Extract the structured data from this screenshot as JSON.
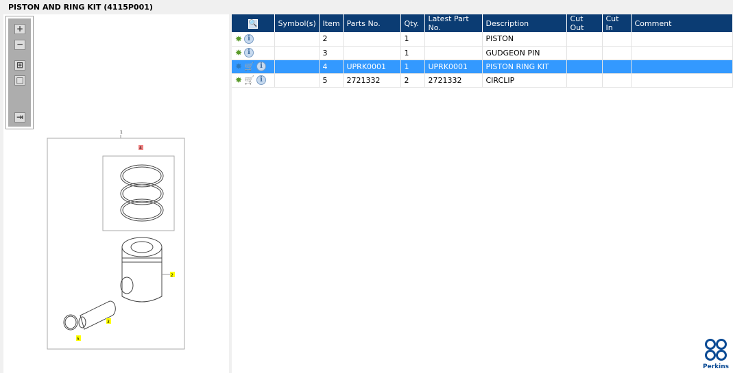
{
  "title": "PISTON AND RING KIT (4115P001)",
  "toolbar": {
    "zoom_in": "+",
    "zoom_out": "−",
    "fit": "⊞",
    "actual": "□",
    "toggle": "⇥"
  },
  "diagram": {
    "callouts": {
      "main": "1",
      "piston": "2",
      "pin": "3",
      "ringkit": "4",
      "circlip": "5"
    }
  },
  "table": {
    "columns": [
      "",
      "Symbol(s)",
      "Item",
      "Parts No.",
      "Qty.",
      "Latest Part No.",
      "Description",
      "Cut Out",
      "Cut In",
      "Comment"
    ],
    "rows": [
      {
        "icons": [
          "gear-icon",
          "info-icon"
        ],
        "symbols": "",
        "item": "2",
        "parts_no": "",
        "qty": "1",
        "latest": "",
        "description": "PISTON",
        "cut_out": "",
        "cut_in": "",
        "comment": "",
        "selected": false
      },
      {
        "icons": [
          "gear-icon",
          "info-icon"
        ],
        "symbols": "",
        "item": "3",
        "parts_no": "",
        "qty": "1",
        "latest": "",
        "description": "GUDGEON PIN",
        "cut_out": "",
        "cut_in": "",
        "comment": "",
        "selected": false
      },
      {
        "icons": [
          "gears-icon",
          "cart-icon",
          "info-icon"
        ],
        "symbols": "",
        "item": "4",
        "parts_no": "UPRK0001",
        "qty": "1",
        "latest": "UPRK0001",
        "description": "PISTON RING KIT",
        "cut_out": "",
        "cut_in": "",
        "comment": "",
        "selected": true
      },
      {
        "icons": [
          "gear-icon",
          "cart-icon",
          "info-icon"
        ],
        "symbols": "",
        "item": "5",
        "parts_no": "2721332",
        "qty": "2",
        "latest": "2721332",
        "description": "CIRCLIP",
        "cut_out": "",
        "cut_in": "",
        "comment": "",
        "selected": false
      }
    ]
  },
  "brand": {
    "name": "Perkins",
    "color": "#0a4a94"
  },
  "colors": {
    "header": "#0b3c73",
    "selected": "#3399ff"
  }
}
